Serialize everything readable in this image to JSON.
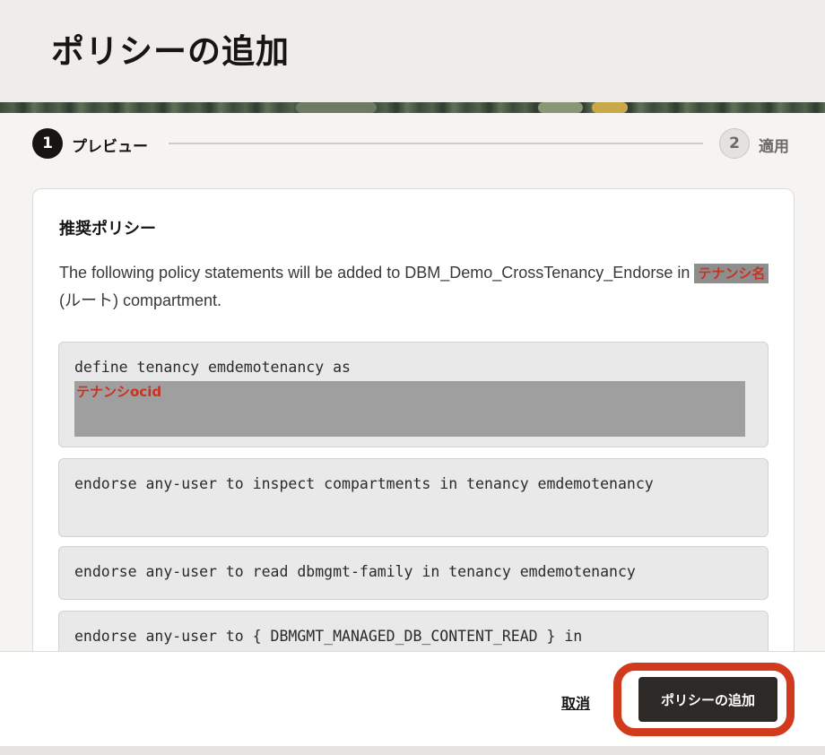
{
  "header": {
    "title": "ポリシーの追加"
  },
  "stepper": {
    "steps": [
      {
        "number": "1",
        "label": "プレビュー"
      },
      {
        "number": "2",
        "label": "適用"
      }
    ]
  },
  "card": {
    "title": "推奨ポリシー",
    "description_prefix": "The following policy statements will be added to DBM_Demo_CrossTenancy_Endorse in ",
    "redacted_name": "テナンシ名",
    "description_suffix": " (ルート) compartment.",
    "statements": [
      {
        "text": "define tenancy emdemotenancy as",
        "redacted": "テナンシocid"
      },
      {
        "text": "endorse any-user to inspect compartments in tenancy emdemotenancy"
      },
      {
        "text": "endorse any-user to read dbmgmt-family in tenancy emdemotenancy"
      },
      {
        "text": "endorse any-user to { DBMGMT_MANAGED_DB_CONTENT_READ } in"
      }
    ]
  },
  "footer": {
    "cancel_label": "取消",
    "submit_label": "ポリシーの追加"
  },
  "colors": {
    "primary_button": "#2c2926",
    "highlight": "#d23a1e",
    "redaction_text": "#c8331f"
  }
}
